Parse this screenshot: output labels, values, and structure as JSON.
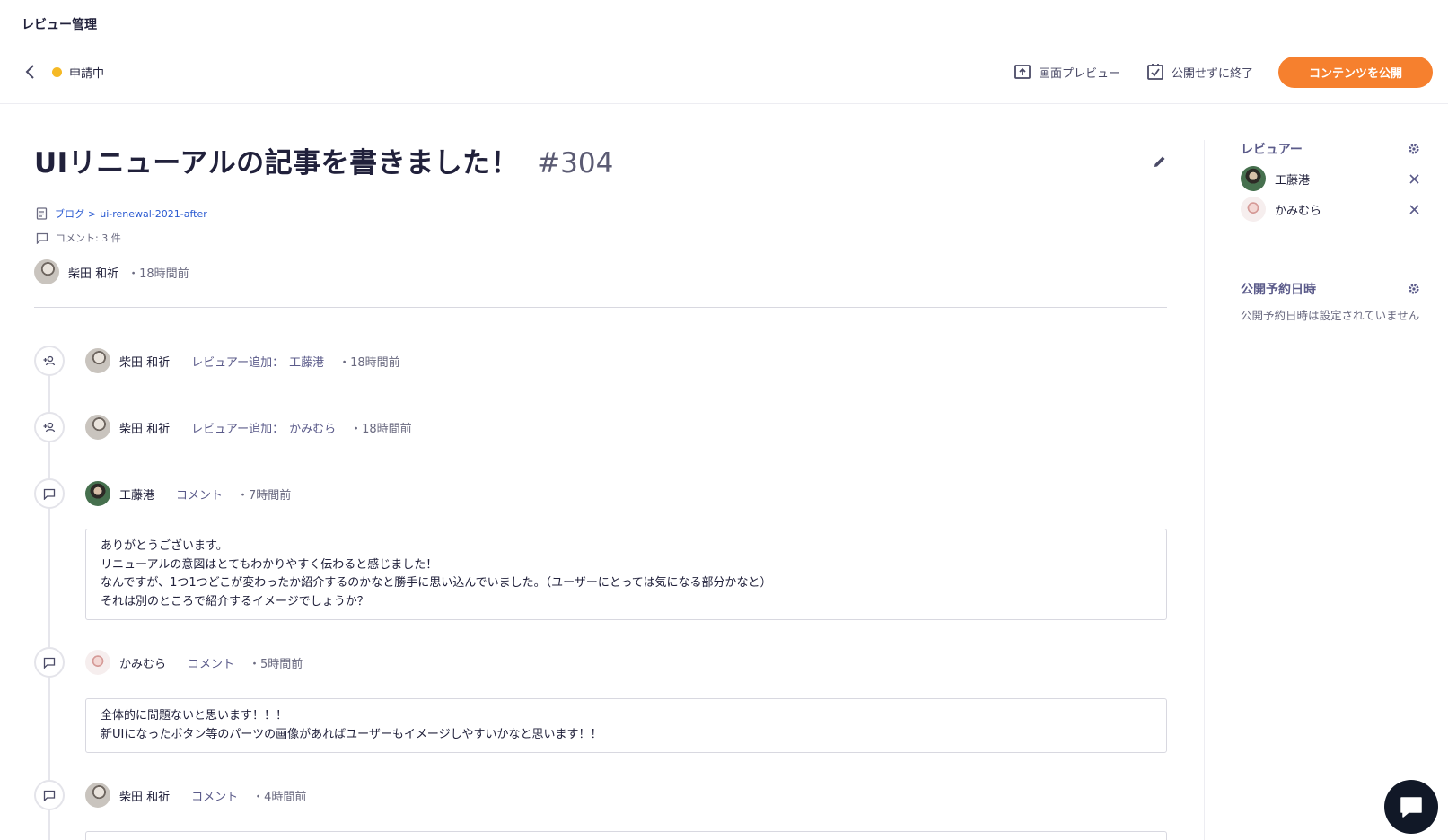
{
  "app": {
    "title": "レビュー管理"
  },
  "toolbar": {
    "status": "申請中",
    "status_color": "#f5b925",
    "preview_label": "画面プレビュー",
    "finish_label": "公開せずに終了",
    "publish_label": "コンテンツを公開",
    "publish_color": "#f6802e"
  },
  "review": {
    "title": "UIリニューアルの記事を書きました！",
    "number": "#304",
    "api_name": "ブログ",
    "content_id": "ui-renewal-2021-after",
    "comment_count": "コメント: 3 件",
    "author": "柴田 和祈",
    "time": "・18時間前"
  },
  "timeline": [
    {
      "type": "reviewer-add",
      "icon": "add-user-icon",
      "user": "柴田 和祈",
      "action": "レビュアー追加：",
      "target": "工藤港",
      "time": "・18時間前"
    },
    {
      "type": "reviewer-add",
      "icon": "add-user-icon",
      "user": "柴田 和祈",
      "action": "レビュアー追加：",
      "target": "かみむら",
      "time": "・18時間前"
    },
    {
      "type": "comment",
      "icon": "comment-icon",
      "user": "工藤港",
      "action": "コメント",
      "time": "・7時間前",
      "lines": [
        "ありがとうございます。",
        "リニューアルの意図はとてもわかりやすく伝わると感じました！",
        "なんですが、1つ1つどこが変わったか紹介するのかなと勝手に思い込んでいました。（ユーザーにとっては気になる部分かなと）",
        "それは別のところで紹介するイメージでしょうか？"
      ]
    },
    {
      "type": "comment",
      "icon": "comment-icon",
      "user": "かみむら",
      "action": "コメント",
      "time": "・5時間前",
      "lines": [
        "全体的に問題ないと思います！！！",
        "新UIになったボタン等のパーツの画像があればユーザーもイメージしやすいかなと思います！！"
      ]
    },
    {
      "type": "comment",
      "icon": "comment-icon",
      "user": "柴田 和祈",
      "action": "コメント",
      "time": "・4時間前"
    }
  ],
  "sidebar": {
    "reviewers_title": "レビュアー",
    "reviewers": [
      {
        "name": "工藤港"
      },
      {
        "name": "かみむら"
      }
    ],
    "schedule_title": "公開予約日時",
    "schedule_text": "公開予約日時は設定されていません"
  }
}
